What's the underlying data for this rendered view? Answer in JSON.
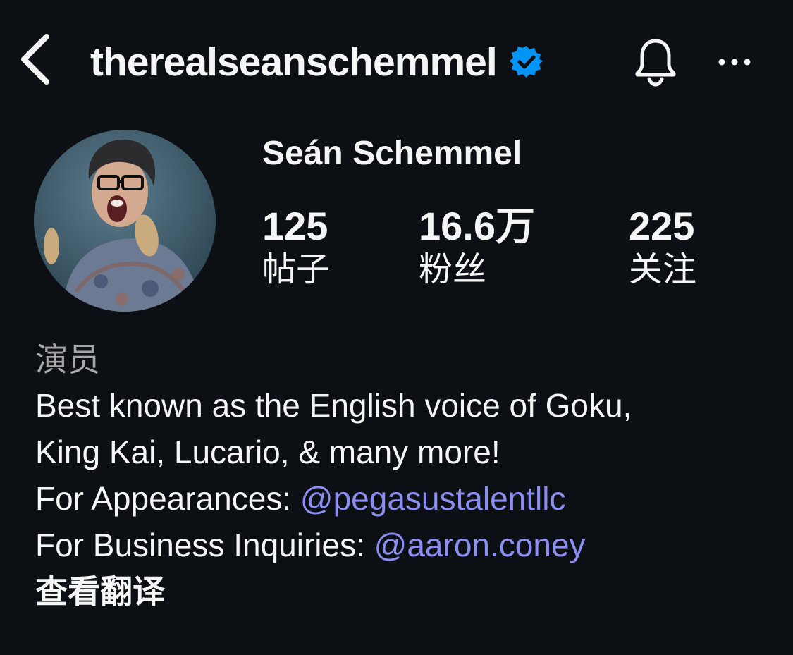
{
  "header": {
    "username": "therealseanschemmel",
    "verified": true,
    "icons": {
      "back": "chevron-left-icon",
      "verified": "verified-badge-icon",
      "notifications": "bell-icon",
      "more": "more-horizontal-icon"
    }
  },
  "profile": {
    "display_name": "Seán Schemmel",
    "stats": {
      "posts": {
        "value": "125",
        "label": "帖子"
      },
      "followers": {
        "value": "16.6万",
        "label": "粉丝"
      },
      "following": {
        "value": "225",
        "label": "关注"
      }
    }
  },
  "bio": {
    "category": "演员",
    "line1": "Best known as the English voice of Goku,",
    "line2": "King Kai, Lucario, & many more!",
    "line3_prefix": "For Appearances: ",
    "line3_mention": "@pegasustalentllc",
    "line4_prefix": "For Business Inquiries: ",
    "line4_mention": "@aaron.coney",
    "see_translation": "查看翻译"
  },
  "colors": {
    "background": "#0c1014",
    "text": "#f5f5f5",
    "muted": "#a8a8a8",
    "mention": "#8c8ff2",
    "verified": "#0095f6"
  }
}
